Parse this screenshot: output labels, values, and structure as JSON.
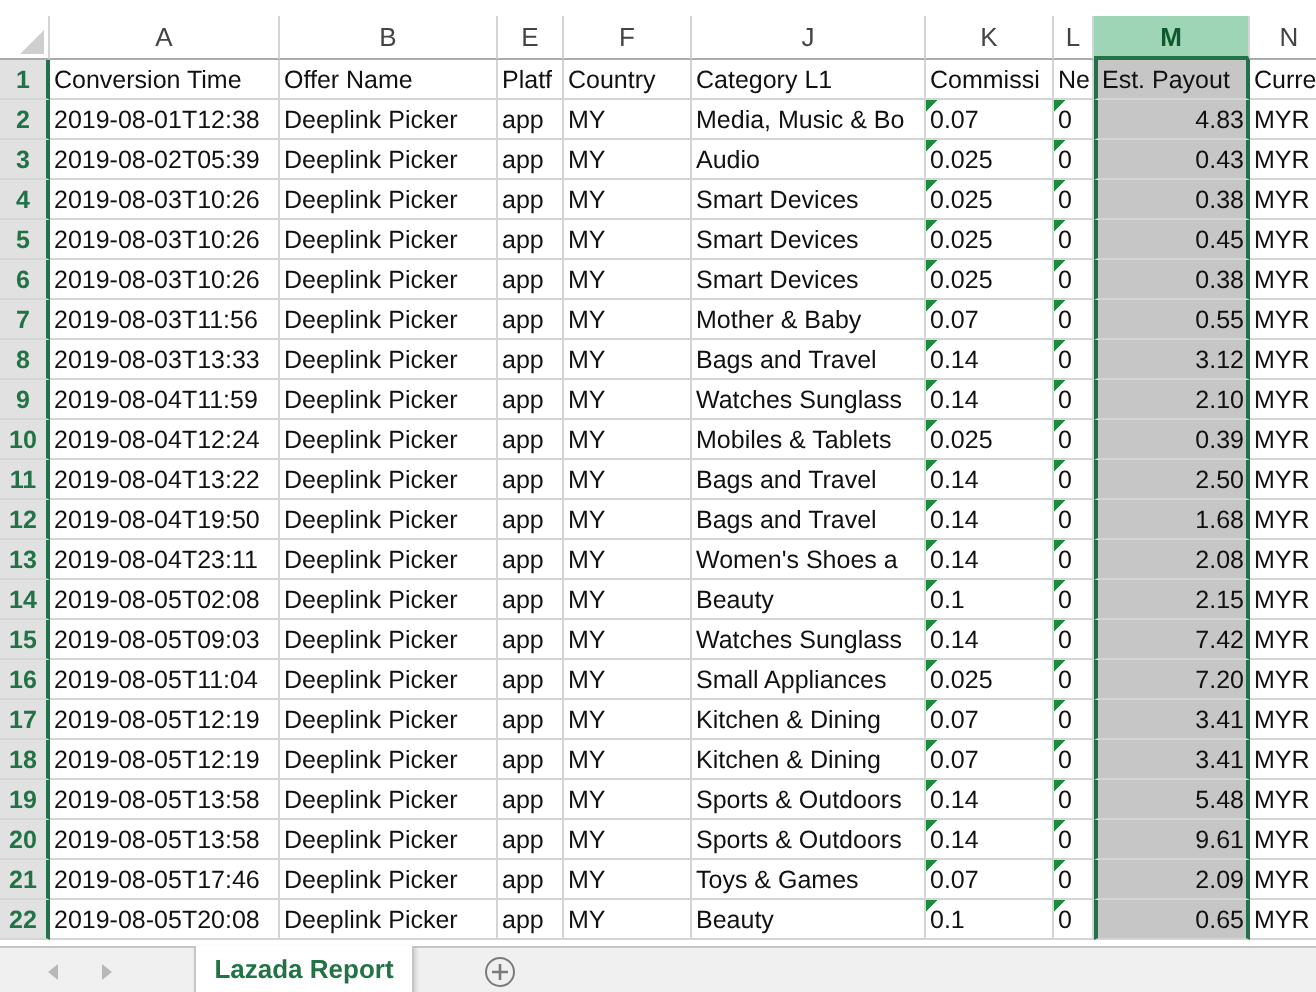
{
  "columns": [
    {
      "letter": "A",
      "selected": false,
      "flagged": false,
      "numeric": false
    },
    {
      "letter": "B",
      "selected": false,
      "flagged": false,
      "numeric": false
    },
    {
      "letter": "E",
      "selected": false,
      "flagged": false,
      "numeric": false
    },
    {
      "letter": "F",
      "selected": false,
      "flagged": false,
      "numeric": false
    },
    {
      "letter": "J",
      "selected": false,
      "flagged": false,
      "numeric": false
    },
    {
      "letter": "K",
      "selected": false,
      "flagged": true,
      "numeric": false
    },
    {
      "letter": "L",
      "selected": false,
      "flagged": true,
      "numeric": false
    },
    {
      "letter": "M",
      "selected": true,
      "flagged": false,
      "numeric": true
    },
    {
      "letter": "N",
      "selected": false,
      "flagged": false,
      "numeric": false
    }
  ],
  "rows": [
    {
      "number": "1",
      "cells": [
        "Conversion Time",
        "Offer Name",
        "Platf",
        "Country",
        "Category L1",
        "Commissi",
        "Ne",
        "Est. Payout",
        "Curre"
      ]
    },
    {
      "number": "2",
      "cells": [
        "2019-08-01T12:38",
        "Deeplink Picker",
        "app",
        "MY",
        "Media, Music & Bo",
        "0.07",
        "0",
        "4.83",
        "MYR"
      ]
    },
    {
      "number": "3",
      "cells": [
        "2019-08-02T05:39",
        "Deeplink Picker",
        "app",
        "MY",
        "Audio",
        "0.025",
        "0",
        "0.43",
        "MYR"
      ]
    },
    {
      "number": "4",
      "cells": [
        "2019-08-03T10:26",
        "Deeplink Picker",
        "app",
        "MY",
        "Smart Devices",
        "0.025",
        "0",
        "0.38",
        "MYR"
      ]
    },
    {
      "number": "5",
      "cells": [
        "2019-08-03T10:26",
        "Deeplink Picker",
        "app",
        "MY",
        "Smart Devices",
        "0.025",
        "0",
        "0.45",
        "MYR"
      ]
    },
    {
      "number": "6",
      "cells": [
        "2019-08-03T10:26",
        "Deeplink Picker",
        "app",
        "MY",
        "Smart Devices",
        "0.025",
        "0",
        "0.38",
        "MYR"
      ]
    },
    {
      "number": "7",
      "cells": [
        "2019-08-03T11:56",
        "Deeplink Picker",
        "app",
        "MY",
        "Mother & Baby",
        "0.07",
        "0",
        "0.55",
        "MYR"
      ]
    },
    {
      "number": "8",
      "cells": [
        "2019-08-03T13:33",
        "Deeplink Picker",
        "app",
        "MY",
        "Bags and Travel",
        "0.14",
        "0",
        "3.12",
        "MYR"
      ]
    },
    {
      "number": "9",
      "cells": [
        "2019-08-04T11:59",
        "Deeplink Picker",
        "app",
        "MY",
        "Watches Sunglass",
        "0.14",
        "0",
        "2.10",
        "MYR"
      ]
    },
    {
      "number": "10",
      "cells": [
        "2019-08-04T12:24",
        "Deeplink Picker",
        "app",
        "MY",
        "Mobiles & Tablets",
        "0.025",
        "0",
        "0.39",
        "MYR"
      ]
    },
    {
      "number": "11",
      "cells": [
        "2019-08-04T13:22",
        "Deeplink Picker",
        "app",
        "MY",
        "Bags and Travel",
        "0.14",
        "0",
        "2.50",
        "MYR"
      ]
    },
    {
      "number": "12",
      "cells": [
        "2019-08-04T19:50",
        "Deeplink Picker",
        "app",
        "MY",
        "Bags and Travel",
        "0.14",
        "0",
        "1.68",
        "MYR"
      ]
    },
    {
      "number": "13",
      "cells": [
        "2019-08-04T23:11",
        "Deeplink Picker",
        "app",
        "MY",
        "Women's Shoes a",
        "0.14",
        "0",
        "2.08",
        "MYR"
      ]
    },
    {
      "number": "14",
      "cells": [
        "2019-08-05T02:08",
        "Deeplink Picker",
        "app",
        "MY",
        "Beauty",
        "0.1",
        "0",
        "2.15",
        "MYR"
      ]
    },
    {
      "number": "15",
      "cells": [
        "2019-08-05T09:03",
        "Deeplink Picker",
        "app",
        "MY",
        "Watches Sunglass",
        "0.14",
        "0",
        "7.42",
        "MYR"
      ]
    },
    {
      "number": "16",
      "cells": [
        "2019-08-05T11:04",
        "Deeplink Picker",
        "app",
        "MY",
        "Small Appliances",
        "0.025",
        "0",
        "7.20",
        "MYR"
      ]
    },
    {
      "number": "17",
      "cells": [
        "2019-08-05T12:19",
        "Deeplink Picker",
        "app",
        "MY",
        "Kitchen & Dining",
        "0.07",
        "0",
        "3.41",
        "MYR"
      ]
    },
    {
      "number": "18",
      "cells": [
        "2019-08-05T12:19",
        "Deeplink Picker",
        "app",
        "MY",
        "Kitchen & Dining",
        "0.07",
        "0",
        "3.41",
        "MYR"
      ]
    },
    {
      "number": "19",
      "cells": [
        "2019-08-05T13:58",
        "Deeplink Picker",
        "app",
        "MY",
        "Sports & Outdoors",
        "0.14",
        "0",
        "5.48",
        "MYR"
      ]
    },
    {
      "number": "20",
      "cells": [
        "2019-08-05T13:58",
        "Deeplink Picker",
        "app",
        "MY",
        "Sports & Outdoors",
        "0.14",
        "0",
        "9.61",
        "MYR"
      ]
    },
    {
      "number": "21",
      "cells": [
        "2019-08-05T17:46",
        "Deeplink Picker",
        "app",
        "MY",
        "Toys & Games",
        "0.07",
        "0",
        "2.09",
        "MYR"
      ]
    },
    {
      "number": "22",
      "cells": [
        "2019-08-05T20:08",
        "Deeplink Picker",
        "app",
        "MY",
        "Beauty",
        "0.1",
        "0",
        "0.65",
        "MYR"
      ]
    }
  ],
  "sheet_tabs": [
    {
      "label": "Lazada Report",
      "selected": true
    }
  ]
}
